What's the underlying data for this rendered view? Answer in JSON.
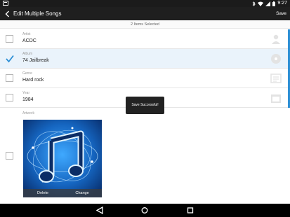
{
  "status_bar": {
    "time": "9:27",
    "left_icon": "sd-card-icon",
    "right_icons": [
      "bluetooth-icon",
      "wifi-icon",
      "signal-icon",
      "battery-icon"
    ]
  },
  "app_bar": {
    "title": "Edit Multiple Songs",
    "save_label": "Save"
  },
  "selection_info": "2 Items Selected",
  "fields": [
    {
      "label": "Artist",
      "value": "ACDC",
      "checked": false,
      "icon": "person-icon"
    },
    {
      "label": "Album",
      "value": "74 Jailbreak",
      "checked": true,
      "icon": "disc-icon"
    },
    {
      "label": "Genre",
      "value": "Hard rock",
      "checked": false,
      "icon": "genre-icon"
    },
    {
      "label": "Year",
      "value": "1984",
      "checked": false,
      "icon": "calendar-icon"
    }
  ],
  "artwork": {
    "label": "Artwork",
    "checked": false,
    "delete_label": "Delete",
    "change_label": "Change"
  },
  "toast": "Save Successful!",
  "nav_bar": {
    "icons": [
      "back-triangle-icon",
      "home-circle-icon",
      "recents-square-icon"
    ]
  },
  "colors": {
    "accent": "#2d8fd5",
    "app_bar": "#1f1f1f",
    "selected_row": "#eaf3fb"
  }
}
